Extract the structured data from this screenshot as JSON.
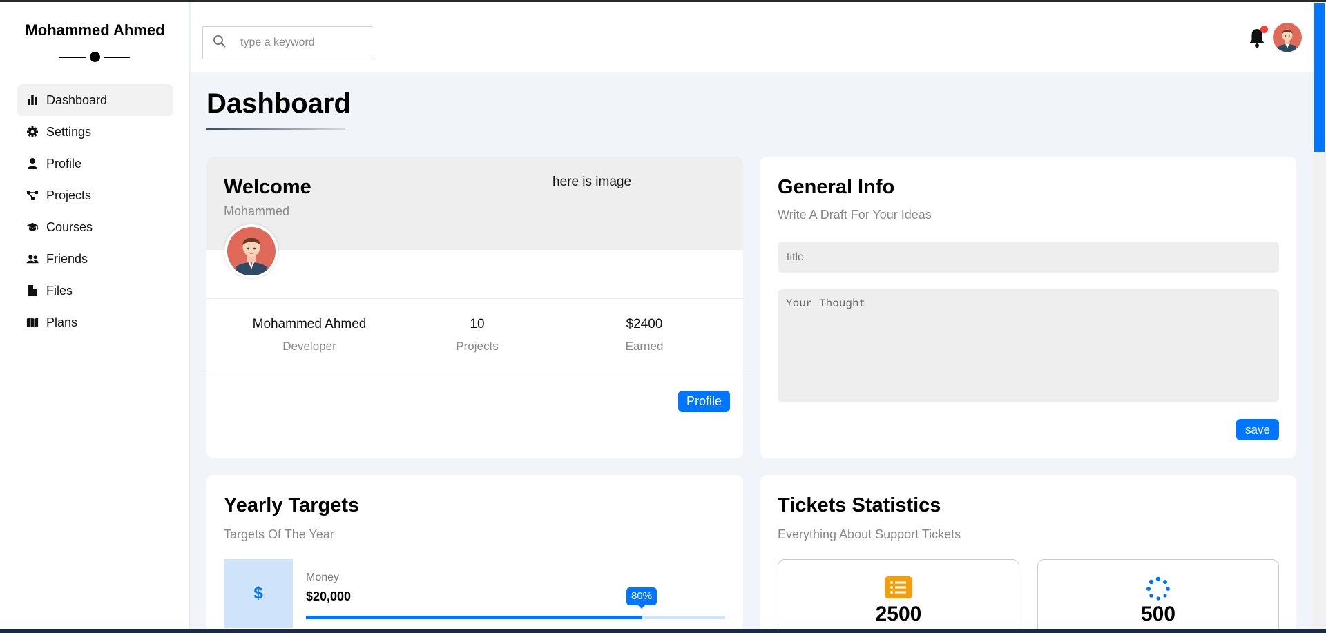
{
  "sidebar": {
    "brand": "Mohammed Ahmed",
    "items": [
      {
        "label": "Dashboard",
        "icon": "chart-simple-icon",
        "active": true
      },
      {
        "label": "Settings",
        "icon": "gear-icon"
      },
      {
        "label": "Profile",
        "icon": "user-icon"
      },
      {
        "label": "Projects",
        "icon": "diagram-project-icon"
      },
      {
        "label": "Courses",
        "icon": "graduation-cap-icon"
      },
      {
        "label": "Friends",
        "icon": "users-icon"
      },
      {
        "label": "Files",
        "icon": "file-icon"
      },
      {
        "label": "Plans",
        "icon": "map-icon"
      }
    ]
  },
  "header": {
    "search_placeholder": "type a keyword",
    "notification_badge": true
  },
  "page": {
    "title": "Dashboard"
  },
  "welcome": {
    "title": "Welcome",
    "subtitle": "Mohammed",
    "image_alt": "here is image",
    "stats": [
      {
        "value": "Mohammed Ahmed",
        "label": "Developer"
      },
      {
        "value": "10",
        "label": "Projects"
      },
      {
        "value": "$2400",
        "label": "Earned"
      }
    ],
    "button": "Profile"
  },
  "general_info": {
    "title": "General Info",
    "subtitle": "Write A Draft For Your Ideas",
    "title_placeholder": "title",
    "thought_placeholder": "Your Thought",
    "button": "save"
  },
  "yearly_targets": {
    "title": "Yearly Targets",
    "subtitle": "Targets Of The Year",
    "items": [
      {
        "icon_glyph": "$",
        "label": "Money",
        "value": "$20,000",
        "progress": "80%",
        "progress_fraction": 0.8
      }
    ]
  },
  "tickets": {
    "title": "Tickets Statistics",
    "subtitle": "Everything About Support Tickets",
    "items": [
      {
        "value": "2500",
        "icon": "list-icon",
        "color": "#f59e0b"
      },
      {
        "value": "500",
        "icon": "spinner-icon",
        "color": "#0075ff"
      }
    ]
  },
  "colors": {
    "accent": "#0075ff",
    "background": "#f1f5f9",
    "badge": "#f44336"
  }
}
